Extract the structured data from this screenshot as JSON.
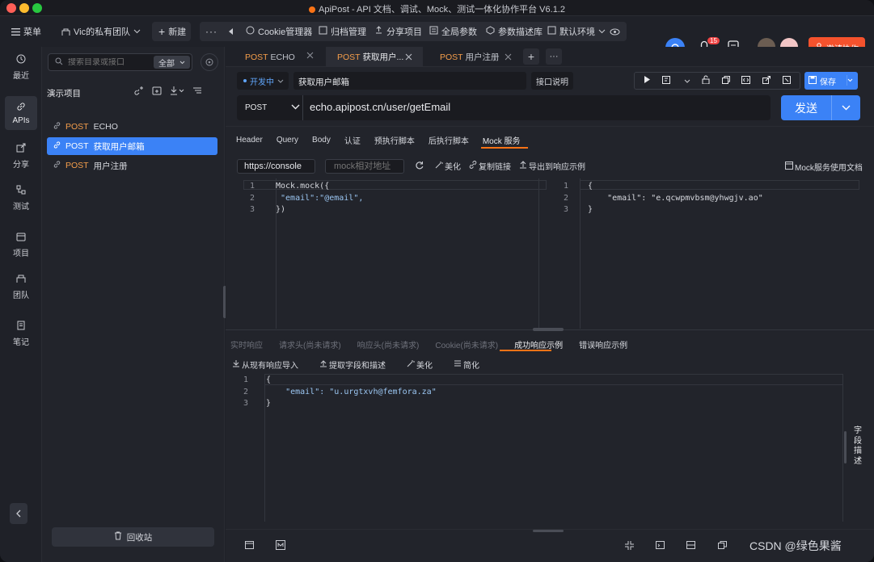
{
  "window": {
    "title": "ApiPost - API 文档、调试、Mock、测试一体化协作平台 V6.1.2"
  },
  "toolbar": {
    "menu": "菜单",
    "team": "Vic的私有团队",
    "new": "新建",
    "items": [
      "Cookie管理器",
      "归档管理",
      "分享项目",
      "全局参数",
      "参数描述库",
      "默认环境"
    ],
    "notif_count": "15",
    "invite": "邀请协作"
  },
  "rail": [
    {
      "label": "最近"
    },
    {
      "label": "APIs"
    },
    {
      "label": "分享"
    },
    {
      "label": "测试"
    },
    {
      "label": "项目"
    },
    {
      "label": "团队"
    },
    {
      "label": "笔记"
    }
  ],
  "sidebar": {
    "search_placeholder": "搜索目录或接口",
    "filter": "全部",
    "project_name": "演示项目",
    "items": [
      {
        "method": "POST",
        "name": "ECHO"
      },
      {
        "method": "POST",
        "name": "获取用户邮箱"
      },
      {
        "method": "POST",
        "name": "用户注册"
      }
    ],
    "recycle": "回收站"
  },
  "tabs": [
    {
      "method": "POST",
      "name": "ECHO"
    },
    {
      "method": "POST",
      "name": "获取用户..."
    },
    {
      "method": "POST",
      "name": "用户注册"
    }
  ],
  "request": {
    "status": "开发中",
    "name": "获取用户邮箱",
    "doc_button": "接口说明",
    "save": "保存",
    "method": "POST",
    "url": "echo.apipost.cn/user/getEmail",
    "send": "发送"
  },
  "req_tabs": [
    "Header",
    "Query",
    "Body",
    "认证",
    "预执行脚本",
    "后执行脚本",
    "Mock 服务"
  ],
  "mock": {
    "url_value": "https://console",
    "path_placeholder": "mock相对地址",
    "beautify": "美化",
    "copy_link": "复制链接",
    "export": "导出到响应示例",
    "docs": "Mock服务使用文档",
    "editor_lines": [
      "Mock.mock({",
      "  \"email\":\"@email\",",
      "})"
    ],
    "preview_lines": [
      "{",
      "    \"email\": \"e.qcwpmvbsm@yhwgjv.ao\"",
      "}"
    ]
  },
  "resp_tabs": [
    "实时响应",
    "请求头(尚未请求)",
    "响应头(尚未请求)",
    "Cookie(尚未请求)",
    "成功响应示例",
    "错误响应示例"
  ],
  "resp_tools": {
    "import": "从现有响应导入",
    "extract": "提取字段和描述",
    "beautify": "美化",
    "simplify": "简化"
  },
  "resp_lines": [
    "{",
    "    \"email\": \"u.urgtxvh@femfora.za\"",
    "}"
  ],
  "side_label": "字段描述",
  "watermark": "CSDN @绿色果酱",
  "colors": {
    "accent": "#3b82f6",
    "method": "#f59e4b",
    "invite": "#f5522d"
  }
}
